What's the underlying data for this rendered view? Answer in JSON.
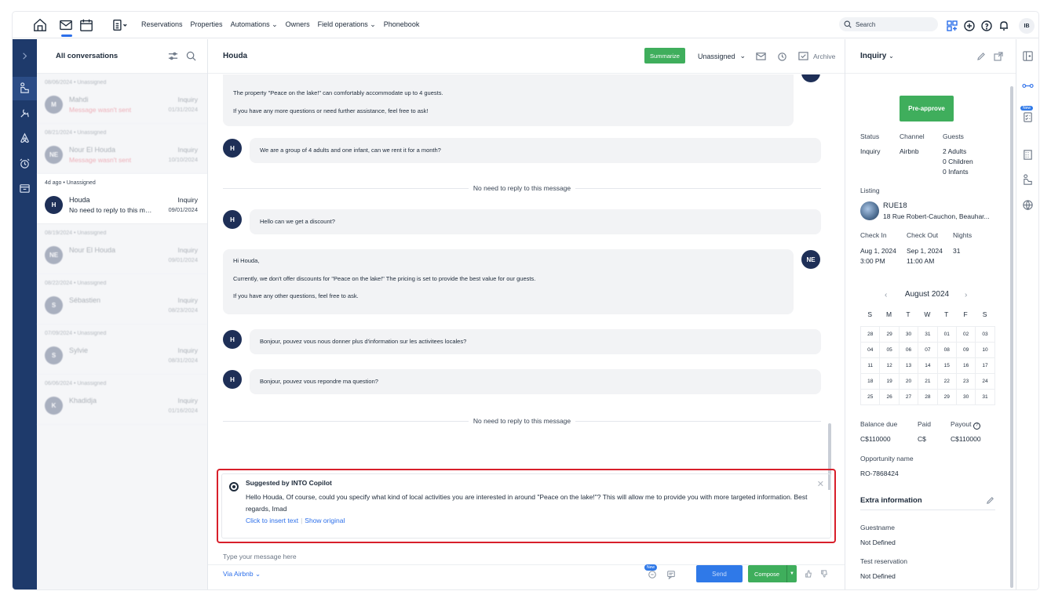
{
  "topnav": {
    "links": [
      "Reservations",
      "Properties",
      "Automations",
      "Owners",
      "Field operations",
      "Phonebook"
    ],
    "search_placeholder": "Search",
    "avatar": "IB"
  },
  "convlist": {
    "title": "All conversations",
    "items": [
      {
        "meta": "08/06/2024 • Unassigned",
        "avatar": "M",
        "name": "Mahdi",
        "sub": "Message wasn't sent",
        "tag": "Inquiry",
        "date": "01/31/2024",
        "error": true
      },
      {
        "meta": "08/21/2024 • Unassigned",
        "avatar": "NE",
        "name": "Nour El Houda",
        "sub": "Message wasn't sent",
        "tag": "Inquiry",
        "date": "10/10/2024",
        "error": true
      },
      {
        "meta": "4d ago • Unassigned",
        "avatar": "H",
        "name": "Houda",
        "sub": "No need to reply to this message",
        "tag": "Inquiry",
        "date": "09/01/2024",
        "error": false
      },
      {
        "meta": "08/19/2024 • Unassigned",
        "avatar": "NE",
        "name": "Nour El Houda",
        "sub": "",
        "tag": "Inquiry",
        "date": "09/01/2024",
        "error": false
      },
      {
        "meta": "08/22/2024 • Unassigned",
        "avatar": "S",
        "name": "Sébastien",
        "sub": "",
        "tag": "Inquiry",
        "date": "08/23/2024",
        "error": false
      },
      {
        "meta": "07/09/2024 • Unassigned",
        "avatar": "S",
        "name": "Sylvie",
        "sub": "",
        "tag": "Inquiry",
        "date": "08/31/2024",
        "error": false
      },
      {
        "meta": "06/06/2024 • Unassigned",
        "avatar": "K",
        "name": "Khadidja",
        "sub": "",
        "tag": "Inquiry",
        "date": "01/16/2024",
        "error": false
      }
    ]
  },
  "chat": {
    "title": "Houda",
    "summarize": "Summarize",
    "assignee": "Unassigned",
    "archive": "Archive",
    "msg1": {
      "p1": "The property \"Peace on the lake!\" can comfortably accommodate up to 4 guests.",
      "p2": "If you have any more questions or need further assistance, feel free to ask!"
    },
    "msg2": {
      "avatar": "H",
      "text": "We are a group of 4 adults and one infant, can we rent it for a month?"
    },
    "divider1": "No need to reply to this message",
    "msg3": {
      "avatar": "H",
      "text": "Hello can we get a discount?"
    },
    "msg4": {
      "avatar": "NE",
      "p1": "Hi Houda,",
      "p2": "Currently, we don't offer discounts for \"Peace on the lake!\" The pricing is set to provide the best value for our guests.",
      "p3": "If you have any other questions, feel free to ask."
    },
    "msg5": {
      "avatar": "H",
      "text": "Bonjour, pouvez vous nous donner plus d'information sur les activitees locales?"
    },
    "msg6": {
      "avatar": "H",
      "text": "Bonjour, pouvez vous repondre ma question?"
    },
    "divider2": "No need to reply to this message",
    "suggestion": {
      "title": "Suggested by INTO Copilot",
      "text": "Hello Houda, Of course, could you specify what kind of local activities you are interested in around \"Peace on the lake!\"? This will allow me to provide you with more targeted information. Best regards, Imad",
      "insert": "Click to insert text",
      "original": "Show original"
    },
    "placeholder": "Type your message here",
    "via": "Via Airbnb",
    "new_badge": "New",
    "send": "Send",
    "compose": "Compose"
  },
  "details": {
    "title": "Inquiry",
    "preapprove": "Pre-approve",
    "status_label": "Status",
    "status": "Inquiry",
    "channel_label": "Channel",
    "channel": "Airbnb",
    "guests_label": "Guests",
    "guests_adults": "2 Adults",
    "guests_children": "0 Children",
    "guests_infants": "0 Infants",
    "listing_label": "Listing",
    "listing_name": "RUE18",
    "listing_address": "18 Rue Robert-Cauchon, Beauhar...",
    "checkin_label": "Check In",
    "checkin_date": "Aug 1, 2024",
    "checkin_time": "3:00 PM",
    "checkout_label": "Check Out",
    "checkout_date": "Sep 1, 2024",
    "checkout_time": "11:00 AM",
    "nights_label": "Nights",
    "nights": "31",
    "calendar": {
      "month": "August 2024",
      "dow": [
        "S",
        "M",
        "T",
        "W",
        "T",
        "F",
        "S"
      ],
      "days": [
        "28",
        "29",
        "30",
        "31",
        "01",
        "02",
        "03",
        "04",
        "05",
        "06",
        "07",
        "08",
        "09",
        "10",
        "11",
        "12",
        "13",
        "14",
        "15",
        "16",
        "17",
        "18",
        "19",
        "20",
        "21",
        "22",
        "23",
        "24",
        "25",
        "26",
        "27",
        "28",
        "29",
        "30",
        "31"
      ]
    },
    "balance_label": "Balance due",
    "balance": "C$110000",
    "paid_label": "Paid",
    "paid": "C$",
    "payout_label": "Payout",
    "payout": "C$110000",
    "opp_label": "Opportunity name",
    "opp": "RO-7868424",
    "extra_title": "Extra information",
    "guestname_label": "Guestname",
    "guestname": "Not Defined",
    "test_label": "Test reservation",
    "test": "Not Defined"
  },
  "farrail": {
    "new": "New"
  }
}
